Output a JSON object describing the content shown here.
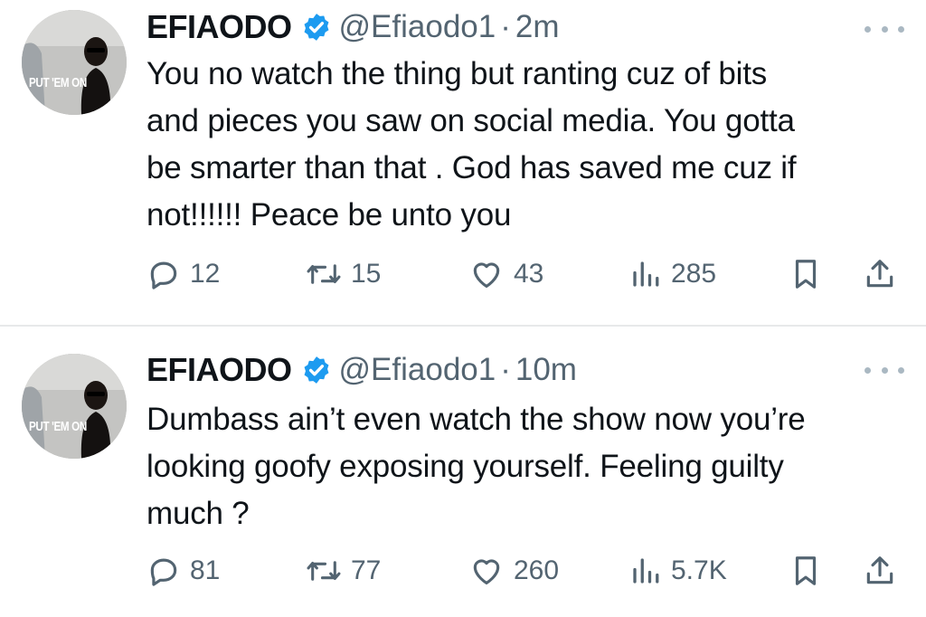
{
  "tweets": [
    {
      "display_name": "EFIAODO",
      "handle": "@Efiaodo1",
      "separator": "·",
      "time": "2m",
      "text": "You no watch the thing but ranting cuz of bits\nand pieces you saw on social media. You gotta\nbe smarter than that . God has saved me cuz if\nnot!!!!!! Peace be unto you",
      "avatar": {
        "caption": "PUT 'EM ON"
      },
      "replies": "12",
      "retweets": "15",
      "likes": "43",
      "views": "285"
    },
    {
      "display_name": "EFIAODO",
      "handle": "@Efiaodo1",
      "separator": "·",
      "time": "10m",
      "text": "Dumbass ain’t even watch the show now you’re\nlooking goofy exposing yourself. Feeling guilty\nmuch ?",
      "avatar": {
        "caption": "PUT 'EM ON"
      },
      "replies": "81",
      "retweets": "77",
      "likes": "260",
      "views": "5.7K"
    }
  ],
  "colors": {
    "verified": "#1d9bf0",
    "text": "#0f1419",
    "secondary": "#536471",
    "divider": "#e7e9ea"
  },
  "icons": [
    "verified-badge-icon",
    "more-icon",
    "reply-icon",
    "retweet-icon",
    "like-icon",
    "views-icon",
    "bookmark-icon",
    "share-icon"
  ]
}
